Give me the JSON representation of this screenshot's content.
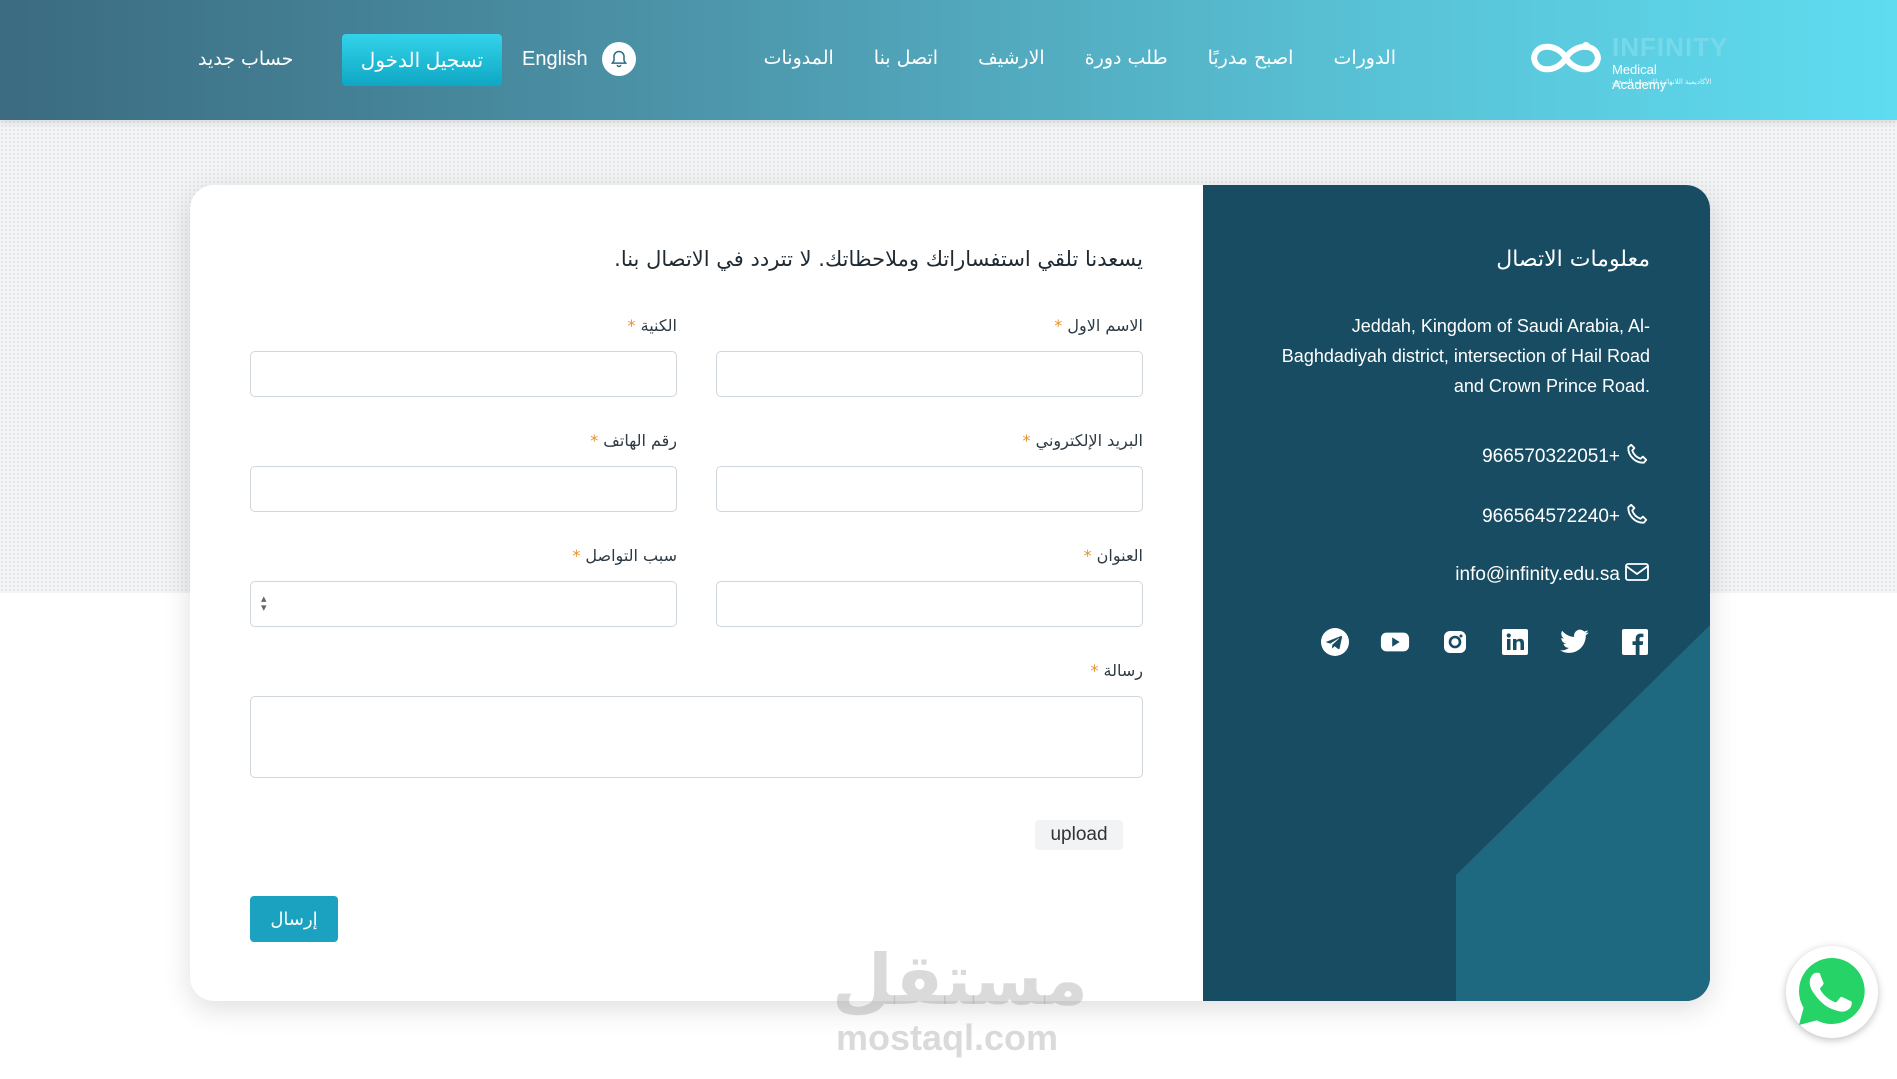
{
  "header": {
    "logo": {
      "brand": "INFINITY",
      "subtitle": "Medical Academy",
      "subtitle_ar": "الأكاديمية اللانهائية للتدريب الصحي"
    },
    "nav": [
      "الدورات",
      "اصبح مدربًا",
      "طلب دورة",
      "الارشيف",
      "اتصل بنا",
      "المدونات"
    ],
    "language": "English",
    "login": "تسجيل الدخول",
    "register": "حساب جديد",
    "icons": {
      "notifications": "bell-icon"
    }
  },
  "contact_info": {
    "title": "معلومات الاتصال",
    "address": "Jeddah, Kingdom of Saudi Arabia, Al-Baghdadiyah district, intersection of Hail Road and Crown Prince Road.",
    "phones": [
      "966570322051+",
      "966564572240+"
    ],
    "email": "info@infinity.edu.sa",
    "socials": [
      "facebook-icon",
      "twitter-icon",
      "linkedin-icon",
      "instagram-icon",
      "youtube-icon",
      "telegram-icon"
    ]
  },
  "form": {
    "intro": "يسعدنا تلقي استفساراتك وملاحظاتك. لا تتردد في الاتصال بنا.",
    "required_mark": "*",
    "first_name": "الاسم الاول",
    "last_name": "الكنية",
    "email": "البريد الإلكتروني",
    "phone": "رقم الهاتف",
    "address": "العنوان",
    "reason": "سبب التواصل",
    "message": "رسالة",
    "upload": "upload",
    "submit": "إرسال"
  },
  "watermark": {
    "ar": "مستقل",
    "en": "mostaql.com"
  },
  "colors": {
    "panel": "#174c62",
    "accent": "#1aa2c0",
    "required": "#e8912b"
  }
}
